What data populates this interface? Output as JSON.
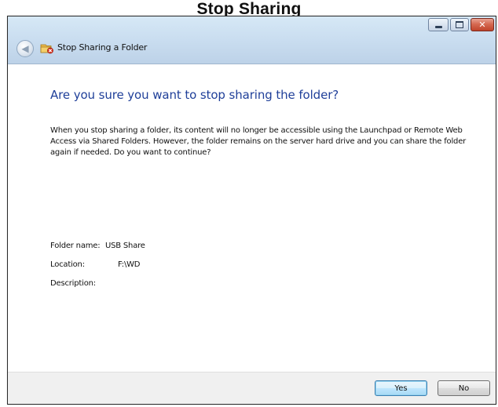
{
  "caption_heading": "Stop Sharing",
  "window": {
    "title": "Stop Sharing a Folder",
    "controls": {
      "minimize_icon": "minimize-icon",
      "maximize_icon": "maximize-icon",
      "close_icon": "close-icon",
      "close_glyph": "✕"
    },
    "back_glyph": "◀"
  },
  "main": {
    "question": "Are you sure you want to stop sharing the folder?",
    "description": "When you stop sharing a folder, its content will no longer be accessible using the Launchpad or Remote Web Access via Shared Folders. However, the folder remains on the server hard drive and you can share the folder again if needed. Do you want to continue?",
    "fields": [
      {
        "label": "Folder name:",
        "value": "USB Share"
      },
      {
        "label": "Location:",
        "value": "F:\\WD"
      },
      {
        "label": "Description:",
        "value": ""
      }
    ]
  },
  "footer": {
    "yes_label": "Yes",
    "no_label": "No"
  },
  "colors": {
    "accent_text": "#1f3f99",
    "titlebar": "#c8dcef",
    "close_button": "#c0432b"
  }
}
